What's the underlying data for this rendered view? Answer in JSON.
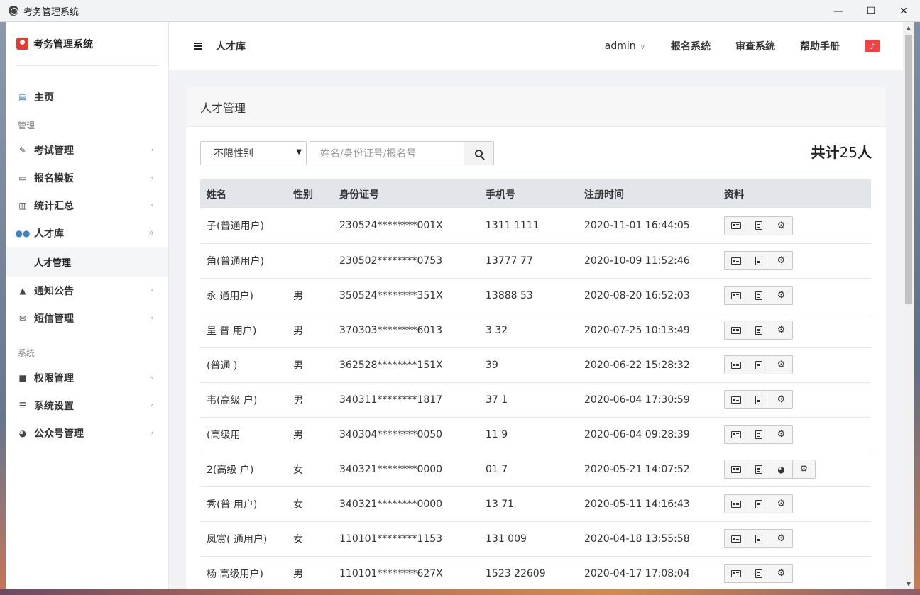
{
  "window": {
    "title": "考务管理系统",
    "minimize": "—",
    "maximize": "☐",
    "close": "✕"
  },
  "sidebar": {
    "brand": "考务管理系统",
    "home": "主页",
    "section_manage": "管理",
    "items_manage": [
      {
        "label": "考试管理",
        "icon": "edit-icon"
      },
      {
        "label": "报名模板",
        "icon": "id-card-icon"
      },
      {
        "label": "统计汇总",
        "icon": "bar-chart-icon"
      },
      {
        "label": "人才库",
        "icon": "users-icon"
      }
    ],
    "sub_talent": "人才管理",
    "items_manage2": [
      {
        "label": "通知公告",
        "icon": "bell-icon"
      },
      {
        "label": "短信管理",
        "icon": "envelope-icon"
      }
    ],
    "section_system": "系统",
    "items_system": [
      {
        "label": "权限管理",
        "icon": "lock-icon"
      },
      {
        "label": "系统设置",
        "icon": "sliders-icon"
      },
      {
        "label": "公众号管理",
        "icon": "wechat-icon"
      }
    ]
  },
  "header": {
    "breadcrumb": "人才库",
    "user": "admin",
    "links": [
      "报名系统",
      "审查系统",
      "帮助手册"
    ]
  },
  "panel": {
    "title": "人才管理",
    "gender_select": "不限性别",
    "search_placeholder": "姓名/身份证号/报名号",
    "total_prefix": "共计",
    "total_count": "25",
    "total_suffix": "人"
  },
  "table": {
    "headers": [
      "姓名",
      "性别",
      "身份证号",
      "手机号",
      "注册时间",
      "资料"
    ],
    "rows": [
      {
        "name": "子(普通用户)",
        "sex": "",
        "id": "230524********001X",
        "phone": "1311 1111",
        "time": "2020-11-01 16:44:05",
        "wechat": false
      },
      {
        "name": "角(普通用户)",
        "sex": "",
        "id": "230502********0753",
        "phone": "13777 77",
        "time": "2020-10-09 11:52:46",
        "wechat": false
      },
      {
        "name": "永 通用户)",
        "sex": "男",
        "id": "350524********351X",
        "phone": "13888 53",
        "time": "2020-08-20 16:52:03",
        "wechat": false
      },
      {
        "name": "呈 普 用户)",
        "sex": "男",
        "id": "370303********6013",
        "phone": "3 32",
        "time": "2020-07-25 10:13:49",
        "wechat": false
      },
      {
        "name": "(普通 )",
        "sex": "男",
        "id": "362528********151X",
        "phone": "39",
        "time": "2020-06-22 15:28:32",
        "wechat": false
      },
      {
        "name": "韦(高级 户)",
        "sex": "男",
        "id": "340311********1817",
        "phone": "37 1",
        "time": "2020-06-04 17:30:59",
        "wechat": false
      },
      {
        "name": "(高级用",
        "sex": "男",
        "id": "340304********0050",
        "phone": "11 9",
        "time": "2020-06-04 09:28:39",
        "wechat": false
      },
      {
        "name": "2(高级 户)",
        "sex": "女",
        "id": "340321********0000",
        "phone": "01 7",
        "time": "2020-05-21 14:07:52",
        "wechat": true
      },
      {
        "name": "秀(普 用户)",
        "sex": "女",
        "id": "340321********0000",
        "phone": "13 71",
        "time": "2020-05-11 14:16:43",
        "wechat": false
      },
      {
        "name": "凤赏( 通用户)",
        "sex": "女",
        "id": "110101********1153",
        "phone": "131 009",
        "time": "2020-04-18 13:55:58",
        "wechat": false
      },
      {
        "name": "杨 高级用户)",
        "sex": "男",
        "id": "110101********627X",
        "phone": "1523 22609",
        "time": "2020-04-17 17:08:04",
        "wechat": false
      }
    ]
  }
}
